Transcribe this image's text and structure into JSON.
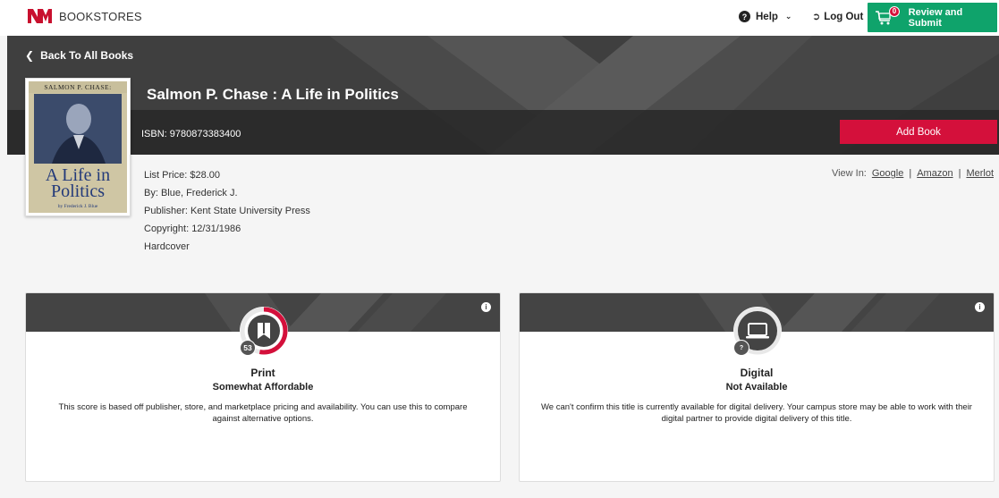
{
  "header": {
    "logo_text": "BOOKSTORES",
    "help_label": "Help",
    "logout_label": "Log Out",
    "review_label": "Review and Submit",
    "cart_count": "0"
  },
  "hero": {
    "back_label": "Back To All Books",
    "title": "Salmon P. Chase : A Life in Politics",
    "isbn": "ISBN: 9780873383400",
    "add_label": "Add Book"
  },
  "cover": {
    "top_text": "SALMON P. CHASE:",
    "title_line1": "A Life in",
    "title_line2": "Politics",
    "author": "by Frederick J. Blue"
  },
  "meta": {
    "list_price": "List Price: $28.00",
    "author": "By: Blue, Frederick J.",
    "publisher": "Publisher: Kent State University Press",
    "copyright": "Copyright: 12/31/1986",
    "format": "Hardcover"
  },
  "view_in": {
    "label": "View In:",
    "links": [
      "Google",
      "Amazon",
      "Merlot"
    ]
  },
  "cards": {
    "print": {
      "score": "53",
      "score_fraction": 0.53,
      "label": "Print",
      "sub": "Somewhat Affordable",
      "desc": "This score is based off publisher, store, and marketplace pricing and availability. You can use this to compare against alternative options."
    },
    "digital": {
      "score": "?",
      "label": "Digital",
      "sub": "Not Available",
      "desc": "We can't confirm this title is currently available for digital delivery. Your campus store may be able to work with their digital partner to provide digital delivery of this title."
    }
  },
  "colors": {
    "accent_green": "#0fa36b",
    "accent_red": "#d4103b",
    "header_dark": "#3f3f3f"
  }
}
